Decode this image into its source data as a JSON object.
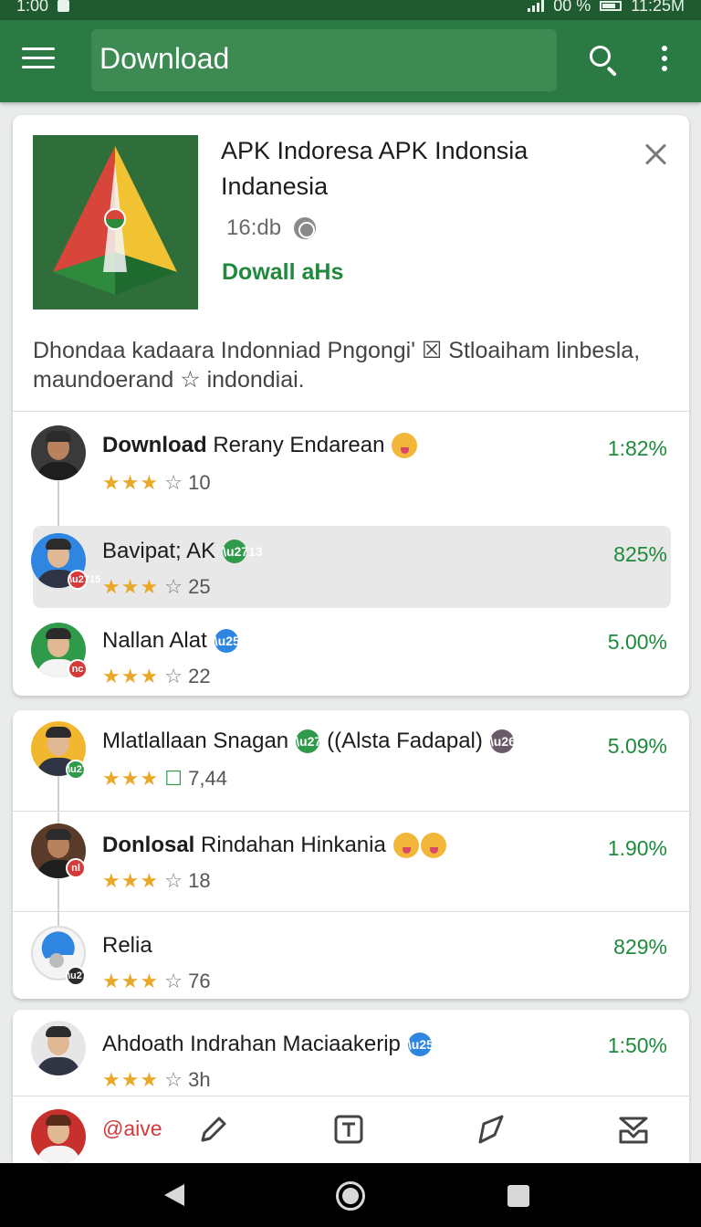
{
  "status_bar": {
    "time": "1:00",
    "battery": "00 %",
    "clock": "11:25M"
  },
  "app_bar": {
    "title": "Download"
  },
  "app_card": {
    "name": "APK Indoresa APK Indonsia Indanesia",
    "size": "16:db",
    "download_link": "Dowall aHs",
    "description": "Dhondaa kadaara Indonniad Pngongi' ☒ Stloaiham linbesla, maundoerand ☆ indondiai."
  },
  "rows": [
    {
      "name_bold": "Download",
      "name": "Rerany Endarean",
      "stars": "★★★",
      "empty_star": "☆",
      "rating": "10",
      "percent": "1:82%"
    },
    {
      "name_bold": "",
      "name": "Bavipat; AK",
      "stars": "★★★",
      "empty_star": "☆",
      "rating": "25",
      "percent": "825%"
    },
    {
      "name_bold": "",
      "name": "Nallan Alat",
      "stars": "★★★",
      "empty_star": "☆",
      "rating": "22",
      "percent": "5.00%"
    },
    {
      "name_bold": "",
      "name": "Mlatlallaan Snagan",
      "name_extra": "((Alsta Fadapal)",
      "stars": "★★★",
      "empty_star": "☐",
      "rating": "7,44",
      "percent": "5.09%"
    },
    {
      "name_bold": "Donlosal",
      "name": "Rindahan Hinkania",
      "stars": "★★★",
      "empty_star": "☆",
      "rating": "18",
      "percent": "1.90%"
    },
    {
      "name_bold": "",
      "name": "Relia",
      "stars": "★★★",
      "empty_star": "☆",
      "rating": "76",
      "percent": "829%"
    },
    {
      "name_bold": "",
      "name": "Ahdoath Indrahan Maciaakerip",
      "stars": "★★★",
      "empty_star": "☆",
      "rating": "3h",
      "percent": "1:50%"
    }
  ],
  "badges": {
    "nc": "nc",
    "ni": "nl"
  },
  "bottom_bar": {
    "save_label": "@aive"
  },
  "colors": {
    "primary": "#2c7a43",
    "accent_text": "#1f8a3c",
    "star": "#e8a92a",
    "verified": "#2f9a4a",
    "info": "#2f86e0"
  },
  "icons": [
    "menu-icon",
    "search-icon",
    "more-vert-icon",
    "close-icon",
    "globe-icon",
    "pen-icon",
    "text-box-icon",
    "arrow-pin-icon",
    "envelope-tray-icon"
  ]
}
